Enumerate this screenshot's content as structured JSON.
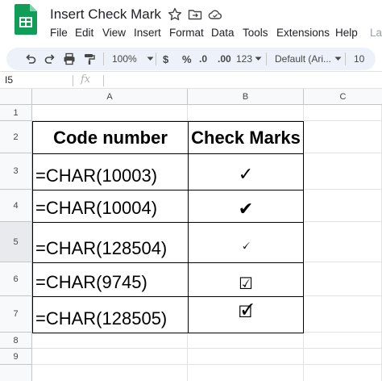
{
  "app": {
    "document_title": "Insert Check Mark",
    "menu": [
      "File",
      "Edit",
      "View",
      "Insert",
      "Format",
      "Data",
      "Tools",
      "Extensions",
      "Help",
      "La"
    ]
  },
  "toolbar": {
    "zoom": "100%",
    "currency": "$",
    "percent": "%",
    "decrease_decimal": ".0",
    "increase_decimal": ".00",
    "more_formats": "123",
    "font": "Default (Ari...",
    "font_size": "10"
  },
  "formula_bar": {
    "cell_ref": "I5",
    "fx_label": "fx",
    "formula": ""
  },
  "grid": {
    "columns": [
      "A",
      "B",
      "C"
    ],
    "rows": [
      "1",
      "2",
      "3",
      "4",
      "5",
      "6",
      "7",
      "8",
      "9"
    ],
    "table": {
      "headers": [
        "Code number",
        "Check Marks"
      ],
      "rows": [
        {
          "code": "=CHAR(10003)",
          "mark": "✓"
        },
        {
          "code": "=CHAR(10004)",
          "mark": "✔"
        },
        {
          "code": "=CHAR(128504)",
          "mark": "🗸"
        },
        {
          "code": "=CHAR(9745)",
          "mark": "☑"
        },
        {
          "code": "=CHAR(128505)",
          "mark": "🗹"
        }
      ]
    }
  },
  "colors": {
    "sheets_green": "#0f9d58",
    "toolbar_bg": "#edf2fa",
    "header_bg": "#f8f9fa"
  }
}
